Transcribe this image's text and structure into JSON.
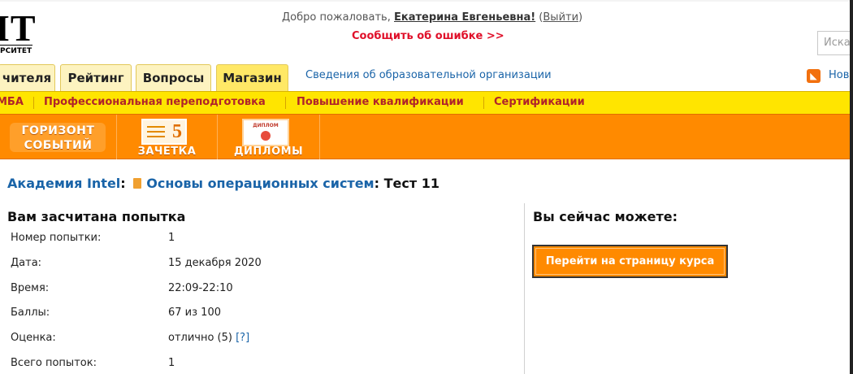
{
  "header": {
    "logo_text": "IT",
    "logo_sub": "РСИТЕТ",
    "welcome_prefix": "Добро пожаловать, ",
    "user_name": "Екатерина Евгеньевна!",
    "logout_open": " (",
    "logout_label": "Выйти",
    "logout_close": ")",
    "report_error": "Сообщить об ошибке >>",
    "search_placeholder": "Иска"
  },
  "tabs": [
    {
      "label": "чителя"
    },
    {
      "label": "Рейтинг"
    },
    {
      "label": "Вопросы"
    },
    {
      "label": "Магазин"
    }
  ],
  "edu_link": "Сведения об образовательной организации",
  "news_link": "Ново",
  "yellow_nav": [
    {
      "label": "МБА"
    },
    {
      "label": "Профессиональная переподготовка"
    },
    {
      "label": "Повышение квалификации"
    },
    {
      "label": "Сертификации"
    }
  ],
  "orange_nav": {
    "gorizont_line1": "ГОРИЗОНТ",
    "gorizont_line2": "СОБЫТИЙ",
    "zachetka_label": "ЗАЧЕТКА",
    "zachetka_num": "5",
    "diplomy_label": "ДИПЛОМЫ",
    "diplom_head": "ДИПЛОМ"
  },
  "breadcrumb": {
    "academy": "Академия Intel",
    "sep1": ":",
    "course": "Основы операционных систем",
    "sep2": ":",
    "test": "Тест 11"
  },
  "attempt": {
    "title": "Вам засчитана попытка",
    "rows": [
      {
        "label": "Номер попытки:",
        "value": "1"
      },
      {
        "label": "Дата:",
        "value": "15 декабря 2020"
      },
      {
        "label": "Время:",
        "value": "22:09-22:10"
      },
      {
        "label": "Баллы:",
        "value": "67 из 100"
      },
      {
        "label": "Оценка:",
        "value": "отлично (5)",
        "help": "[?]"
      },
      {
        "label": "Всего попыток:",
        "value": "1"
      }
    ]
  },
  "actions": {
    "title": "Вы сейчас можете:",
    "go_course": "Перейти на страницу курса"
  },
  "colors": {
    "accent_orange": "#ff8a00",
    "nav_yellow": "#ffe500",
    "link_blue": "#1a64a8",
    "alert_red": "#e0102a",
    "nav_red": "#b0232a"
  }
}
